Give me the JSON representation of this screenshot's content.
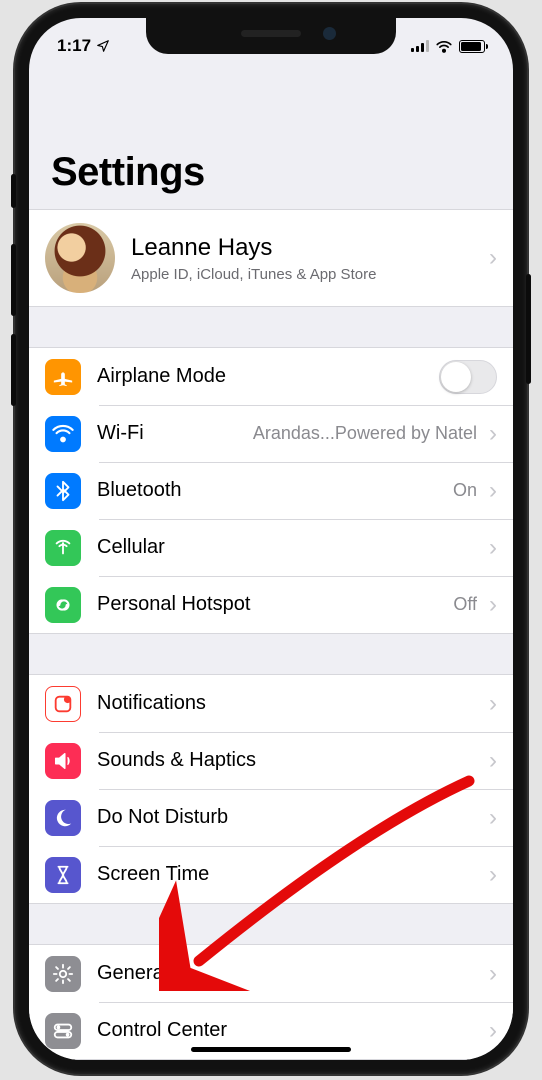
{
  "statusbar": {
    "time": "1:17"
  },
  "page": {
    "title": "Settings"
  },
  "profile": {
    "name": "Leanne Hays",
    "subtitle": "Apple ID, iCloud, iTunes & App Store"
  },
  "groups": [
    {
      "rows": [
        {
          "key": "airplane",
          "label": "Airplane Mode",
          "icon": "airplane-icon",
          "bg": "bg-orange",
          "type": "toggle",
          "on": false
        },
        {
          "key": "wifi",
          "label": "Wi-Fi",
          "detail": "Arandas...Powered by Natel",
          "icon": "wifi-icon",
          "bg": "bg-blue",
          "type": "link"
        },
        {
          "key": "bluetooth",
          "label": "Bluetooth",
          "detail": "On",
          "icon": "bluetooth-icon",
          "bg": "bg-blue",
          "type": "link"
        },
        {
          "key": "cellular",
          "label": "Cellular",
          "icon": "cellular-icon",
          "bg": "bg-green",
          "type": "link"
        },
        {
          "key": "hotspot",
          "label": "Personal Hotspot",
          "detail": "Off",
          "icon": "hotspot-icon",
          "bg": "bg-green",
          "type": "link"
        }
      ]
    },
    {
      "rows": [
        {
          "key": "notifications",
          "label": "Notifications",
          "icon": "notifications-icon",
          "bg": "bg-red",
          "type": "link"
        },
        {
          "key": "sounds",
          "label": "Sounds & Haptics",
          "icon": "sounds-icon",
          "bg": "bg-pink",
          "type": "link"
        },
        {
          "key": "dnd",
          "label": "Do Not Disturb",
          "icon": "moon-icon",
          "bg": "bg-indigo",
          "type": "link"
        },
        {
          "key": "screentime",
          "label": "Screen Time",
          "icon": "hourglass-icon",
          "bg": "bg-indigo",
          "type": "link"
        }
      ]
    },
    {
      "rows": [
        {
          "key": "general",
          "label": "General",
          "icon": "gear-icon",
          "bg": "bg-gray",
          "type": "link"
        },
        {
          "key": "controlcenter",
          "label": "Control Center",
          "icon": "switches-icon",
          "bg": "bg-gray",
          "type": "link"
        }
      ]
    }
  ]
}
